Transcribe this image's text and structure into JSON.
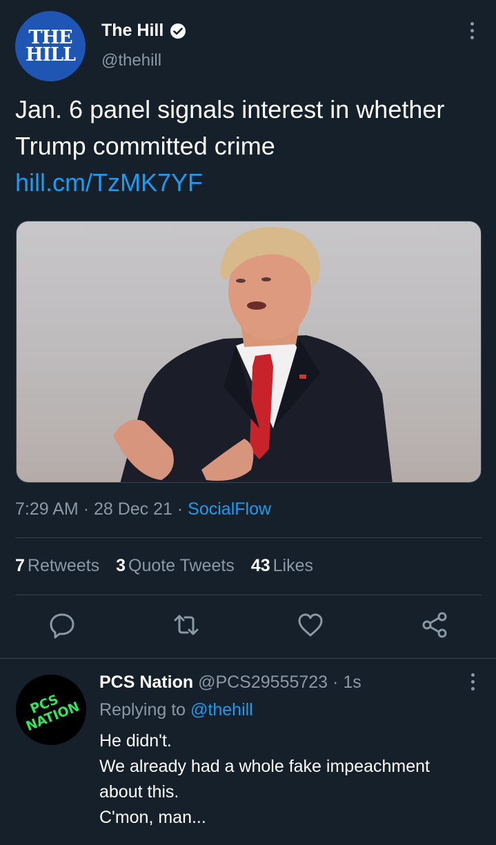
{
  "tweet": {
    "author": {
      "avatar_text_line1": "THE",
      "avatar_text_line2": "HILL",
      "name": "The Hill",
      "handle": "@thehill",
      "verified": true
    },
    "text": "Jan. 6 panel signals interest in whether Trump committed crime",
    "link": "hill.cm/TzMK7YF",
    "time": "7:29 AM",
    "date": "28 Dec 21",
    "source": "SocialFlow",
    "stats": {
      "retweets_count": "7",
      "retweets_label": "Retweets",
      "quotes_count": "3",
      "quotes_label": "Quote Tweets",
      "likes_count": "43",
      "likes_label": "Likes"
    },
    "actions": [
      "reply-icon",
      "retweet-icon",
      "like-icon",
      "share-icon"
    ]
  },
  "reply": {
    "avatar_text_line1": "PCS",
    "avatar_text_line2": "NATION",
    "name": "PCS Nation",
    "handle": "@PCS29555723",
    "time": "1s",
    "replying_to_label": "Replying to",
    "replying_to_handle": "@thehill",
    "lines": [
      "He didn't.",
      "We already had a whole fake impeachment",
      "about this.",
      "C'mon, man..."
    ]
  },
  "colors": {
    "background": "#15202b",
    "accent": "#1d9bf0",
    "muted": "#8b98a5",
    "divider": "#38444d",
    "hill_blue": "#1f56b3",
    "pcs_green": "#39e05a"
  }
}
